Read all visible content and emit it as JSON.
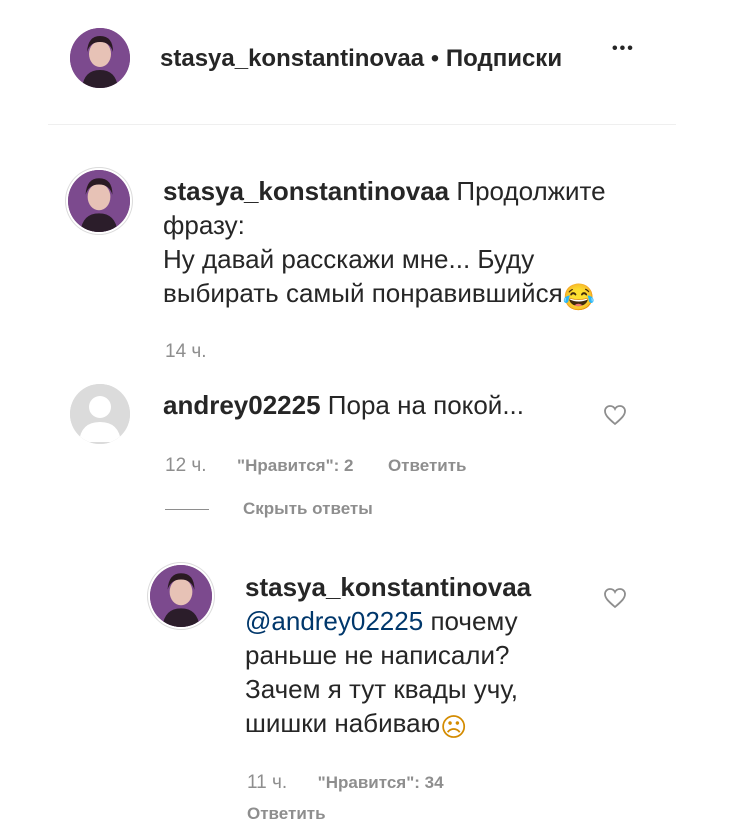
{
  "header": {
    "username": "stasya_konstantinovaa",
    "separator": "•",
    "follow_label": "Подписки",
    "more_label": "•••"
  },
  "caption": {
    "username": "stasya_konstantinovaa",
    "text_line1": "Продолжите",
    "text_line2": "фразу:",
    "text_line3": "Ну давай расскажи мне... Буду",
    "text_line4": "выбирать самый понравившийся",
    "emoji": "😂",
    "time": "14 ч."
  },
  "comment": {
    "username": "andrey02225",
    "text": "Пора на покой...",
    "time": "12 ч.",
    "likes": "\"Нравится\": 2",
    "reply_label": "Ответить",
    "hide_replies_label": "Скрыть ответы"
  },
  "reply": {
    "username": "stasya_konstantinovaa",
    "mention": "@andrey02225",
    "text_line1": "почему",
    "text_line2": "раньше не написали?",
    "text_line3": "Зачем я тут квады учу,",
    "text_line4": "шишки набиваю",
    "emoji": "☹",
    "time": "11 ч.",
    "likes": "\"Нравится\": 34",
    "reply_label": "Ответить"
  },
  "colors": {
    "text": "#262626",
    "muted": "#8e8e8e",
    "mention": "#00376b",
    "divider": "#efefef",
    "avatar_bg": "#8a4f8c"
  },
  "icons": {
    "like": "heart-outline-icon",
    "more": "more-options-icon",
    "default_avatar": "default-avatar-icon"
  }
}
